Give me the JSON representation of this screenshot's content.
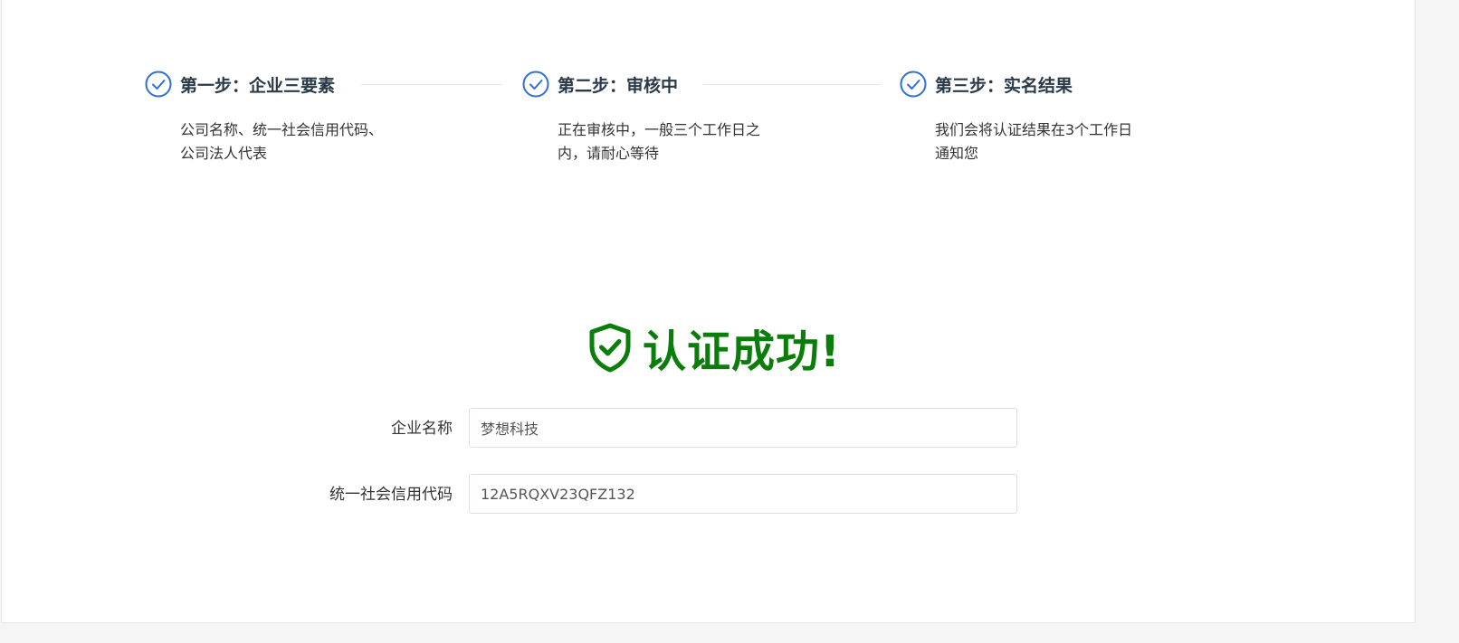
{
  "steps": [
    {
      "title": "第一步：企业三要素",
      "desc_line1": "公司名称、统一社会信用代码、",
      "desc_line2": "公司法人代表"
    },
    {
      "title": "第二步：审核中",
      "desc_line1": "正在审核中，一般三个工作日之",
      "desc_line2": "内，请耐心等待"
    },
    {
      "title": "第三步：实名结果",
      "desc_line1": "我们会将认证结果在3个工作日",
      "desc_line2": "通知您"
    }
  ],
  "result": {
    "text": "认证成功!"
  },
  "form": {
    "company_name_label": "企业名称",
    "company_name_value": "梦想科技",
    "credit_code_label": "统一社会信用代码",
    "credit_code_value": "12A5RQXV23QFZ132"
  },
  "colors": {
    "step_icon": "#2f6fd6",
    "success": "#0a7d0a"
  }
}
